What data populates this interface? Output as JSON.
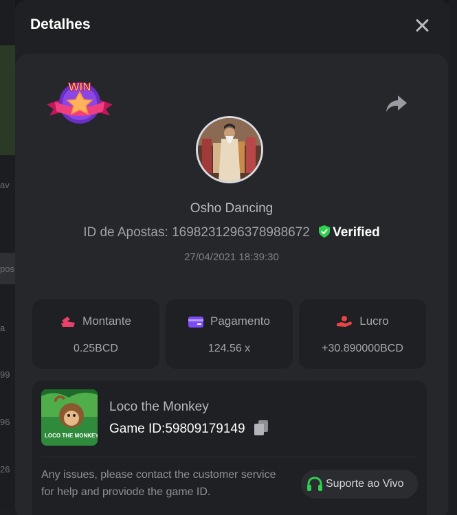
{
  "modal": {
    "title": "Detalhes"
  },
  "bet": {
    "game_name": "Osho Dancing",
    "id_label": "ID de Apostas:",
    "id_value": "1698231296378988672",
    "verified_label": "Verified",
    "timestamp": "27/04/2021 18:39:30",
    "badge_text": "WIN"
  },
  "stats": [
    {
      "label": "Montante",
      "value": "0.25BCD",
      "icon": "coins-icon",
      "color": "#e8416a"
    },
    {
      "label": "Pagamento",
      "value": "124.56 x",
      "icon": "card-icon",
      "color": "#7b4cf5"
    },
    {
      "label": "Lucro",
      "value": "+30.890000BCD",
      "icon": "profit-icon",
      "color": "#e84545"
    }
  ],
  "game": {
    "title": "Loco the Monkey",
    "id_label": "Game ID:",
    "id_value": "59809179149",
    "thumb_text": "LOCO THE MONKEY",
    "help_text": "Any issues, please contact the customer service for help and proviode the game ID.",
    "support_label": "Suporte ao Vivo"
  },
  "background": {
    "left_labels": [
      "av",
      "pos",
      "a",
      "99",
      "96",
      "26"
    ]
  },
  "colors": {
    "verified_shield": "#2fcf4f",
    "support_icon": "#2fcf4f",
    "modal_bg": "#1f2023",
    "card_bg": "#26272b"
  }
}
